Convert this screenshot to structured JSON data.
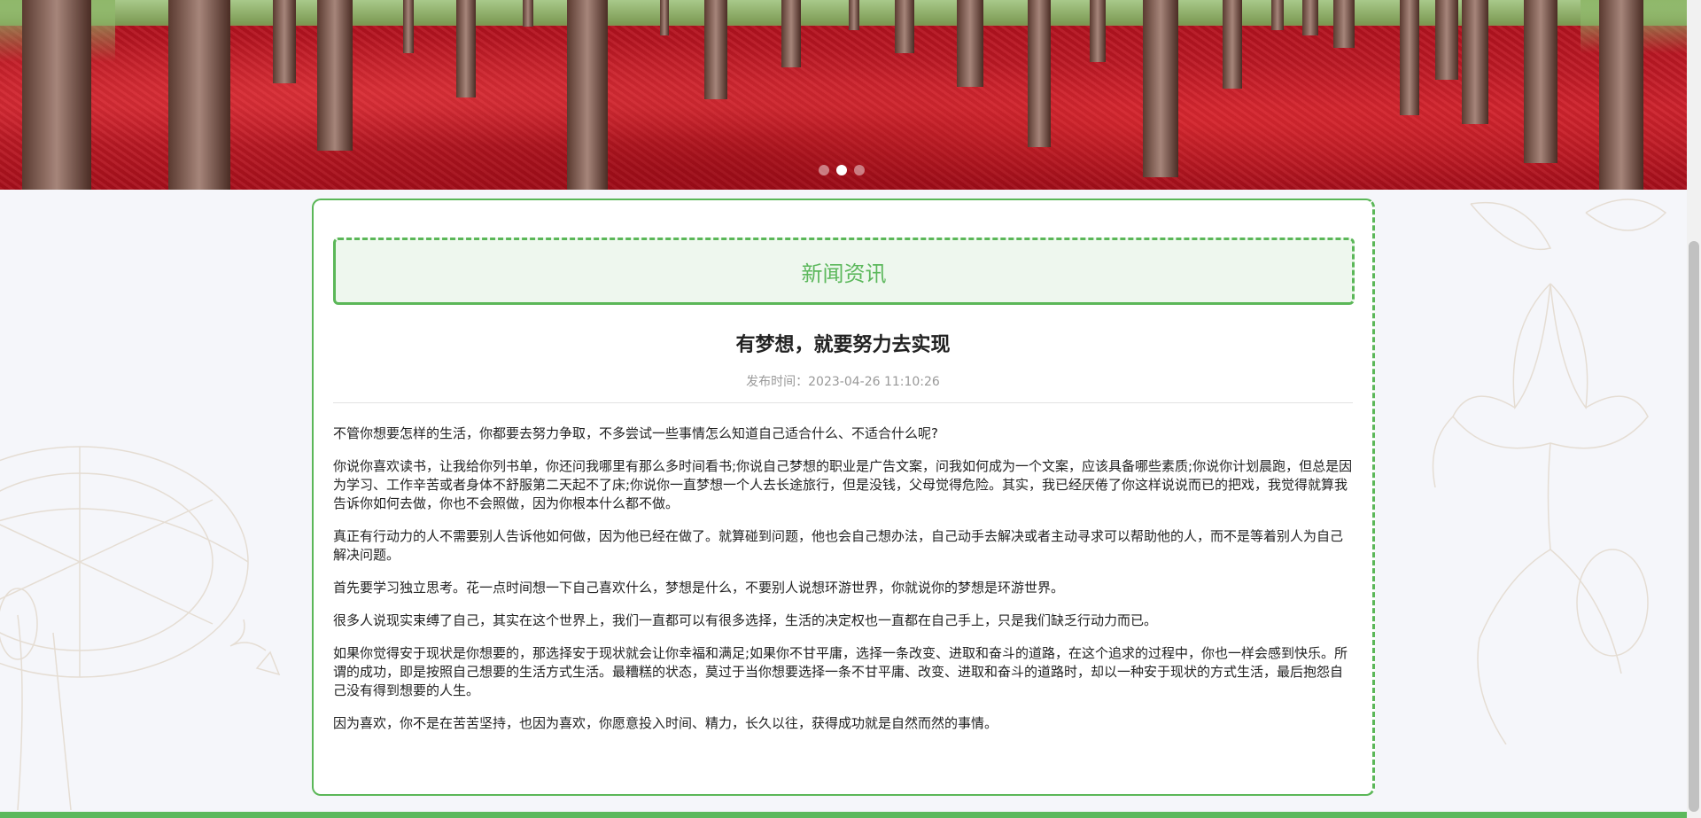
{
  "banner": {
    "slides": [
      {
        "label": "slide-1",
        "active": false
      },
      {
        "label": "slide-2",
        "active": true
      },
      {
        "label": "slide-3",
        "active": false
      }
    ]
  },
  "section": {
    "title": "新闻资讯"
  },
  "article": {
    "title": "有梦想，就要努力去实现",
    "publish_label": "发布时间：",
    "publish_time": "2023-04-26 11:10:26",
    "paragraphs": [
      "不管你想要怎样的生活，你都要去努力争取，不多尝试一些事情怎么知道自己适合什么、不适合什么呢?",
      "你说你喜欢读书，让我给你列书单，你还问我哪里有那么多时间看书;你说自己梦想的职业是广告文案，问我如何成为一个文案，应该具备哪些素质;你说你计划晨跑，但总是因为学习、工作辛苦或者身体不舒服第二天起不了床;你说你一直梦想一个人去长途旅行，但是没钱，父母觉得危险。其实，我已经厌倦了你这样说说而已的把戏，我觉得就算我告诉你如何去做，你也不会照做，因为你根本什么都不做。",
      "真正有行动力的人不需要别人告诉他如何做，因为他已经在做了。就算碰到问题，他也会自己想办法，自己动手去解决或者主动寻求可以帮助他的人，而不是等着别人为自己解决问题。",
      "首先要学习独立思考。花一点时间想一下自己喜欢什么，梦想是什么，不要别人说想环游世界，你就说你的梦想是环游世界。",
      "很多人说现实束缚了自己，其实在这个世界上，我们一直都可以有很多选择，生活的决定权也一直都在自己手上，只是我们缺乏行动力而已。",
      "如果你觉得安于现状是你想要的，那选择安于现状就会让你幸福和满足;如果你不甘平庸，选择一条改变、进取和奋斗的道路，在这个追求的过程中，你也一样会感到快乐。所谓的成功，即是按照自己想要的生活方式生活。最糟糕的状态，莫过于当你想要选择一条不甘平庸、改变、进取和奋斗的道路时，却以一种安于现状的方式生活，最后抱怨自己没有得到想要的人生。",
      "因为喜欢，你不是在苦苦坚持，也因为喜欢，你愿意投入时间、精力，长久以往，获得成功就是自然而然的事情。"
    ]
  },
  "colors": {
    "accent": "#5cb85c",
    "title_bg": "#eef7ee",
    "meta_text": "#999999"
  }
}
